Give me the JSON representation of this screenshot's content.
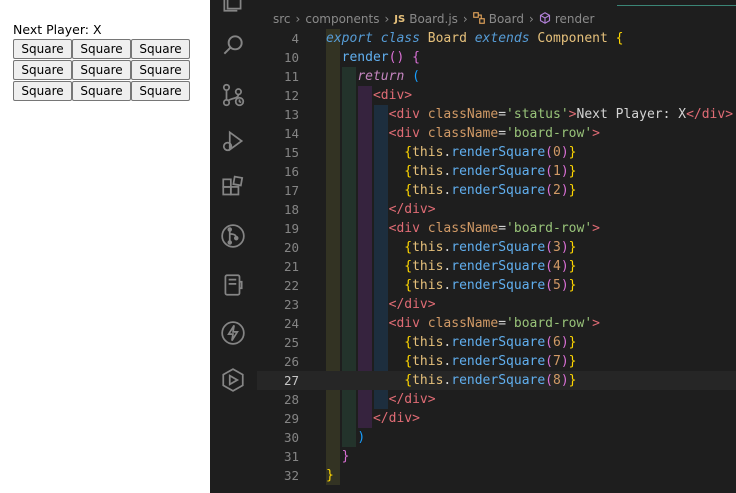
{
  "preview": {
    "status_text": "Next Player: X",
    "rows": [
      [
        "Square",
        "Square",
        "Square"
      ],
      [
        "Square",
        "Square",
        "Square"
      ],
      [
        "Square",
        "Square",
        "Square"
      ]
    ]
  },
  "activity_bar": {
    "icons": [
      "explorer-icon",
      "search-icon",
      "source-control-icon",
      "run-debug-icon",
      "extensions-icon",
      "git-graph-icon",
      "remote-icon",
      "thunder-client-icon",
      "live-share-icon"
    ]
  },
  "breadcrumb": {
    "items": [
      "src",
      "components",
      "Board.js",
      "Board",
      "render"
    ],
    "js_badge": "JS"
  },
  "code_lines": [
    {
      "n": "4",
      "parts": [
        [
          "kw",
          "export"
        ],
        [
          "plain",
          " "
        ],
        [
          "kw",
          "class"
        ],
        [
          "plain",
          " "
        ],
        [
          "cls",
          "Board"
        ],
        [
          "plain",
          " "
        ],
        [
          "kw",
          "extends"
        ],
        [
          "plain",
          " "
        ],
        [
          "cls",
          "Component"
        ],
        [
          "plain",
          " "
        ],
        [
          "br1",
          "{"
        ]
      ]
    },
    {
      "n": "10",
      "parts": [
        [
          "plain",
          "  "
        ],
        [
          "fn",
          "render"
        ],
        [
          "br2",
          "()"
        ],
        [
          "plain",
          " "
        ],
        [
          "br2",
          "{"
        ]
      ]
    },
    {
      "n": "11",
      "parts": [
        [
          "plain",
          "    "
        ],
        [
          "kw2",
          "return"
        ],
        [
          "plain",
          " "
        ],
        [
          "br3",
          "("
        ]
      ]
    },
    {
      "n": "12",
      "parts": [
        [
          "plain",
          "      "
        ],
        [
          "tag",
          "<div>"
        ]
      ]
    },
    {
      "n": "13",
      "parts": [
        [
          "plain",
          "        "
        ],
        [
          "tag",
          "<div"
        ],
        [
          "plain",
          " "
        ],
        [
          "attr",
          "className"
        ],
        [
          "plain",
          "="
        ],
        [
          "str",
          "'status'"
        ],
        [
          "tag",
          ">"
        ],
        [
          "plain",
          "Next Player: X"
        ],
        [
          "tag",
          "</div>"
        ]
      ]
    },
    {
      "n": "14",
      "parts": [
        [
          "plain",
          "        "
        ],
        [
          "tag",
          "<div"
        ],
        [
          "plain",
          " "
        ],
        [
          "attr",
          "className"
        ],
        [
          "plain",
          "="
        ],
        [
          "str",
          "'board-row'"
        ],
        [
          "tag",
          ">"
        ]
      ]
    },
    {
      "n": "15",
      "parts": [
        [
          "plain",
          "          "
        ],
        [
          "br1",
          "{"
        ],
        [
          "th",
          "this"
        ],
        [
          "plain",
          "."
        ],
        [
          "fn",
          "renderSquare"
        ],
        [
          "br2",
          "("
        ],
        [
          "num",
          "0"
        ],
        [
          "br2",
          ")"
        ],
        [
          "br1",
          "}"
        ]
      ]
    },
    {
      "n": "16",
      "parts": [
        [
          "plain",
          "          "
        ],
        [
          "br1",
          "{"
        ],
        [
          "th",
          "this"
        ],
        [
          "plain",
          "."
        ],
        [
          "fn",
          "renderSquare"
        ],
        [
          "br2",
          "("
        ],
        [
          "num",
          "1"
        ],
        [
          "br2",
          ")"
        ],
        [
          "br1",
          "}"
        ]
      ]
    },
    {
      "n": "17",
      "parts": [
        [
          "plain",
          "          "
        ],
        [
          "br1",
          "{"
        ],
        [
          "th",
          "this"
        ],
        [
          "plain",
          "."
        ],
        [
          "fn",
          "renderSquare"
        ],
        [
          "br2",
          "("
        ],
        [
          "num",
          "2"
        ],
        [
          "br2",
          ")"
        ],
        [
          "br1",
          "}"
        ]
      ]
    },
    {
      "n": "18",
      "parts": [
        [
          "plain",
          "        "
        ],
        [
          "tag",
          "</div>"
        ]
      ]
    },
    {
      "n": "19",
      "parts": [
        [
          "plain",
          "        "
        ],
        [
          "tag",
          "<div"
        ],
        [
          "plain",
          " "
        ],
        [
          "attr",
          "className"
        ],
        [
          "plain",
          "="
        ],
        [
          "str",
          "'board-row'"
        ],
        [
          "tag",
          ">"
        ]
      ]
    },
    {
      "n": "20",
      "parts": [
        [
          "plain",
          "          "
        ],
        [
          "br1",
          "{"
        ],
        [
          "th",
          "this"
        ],
        [
          "plain",
          "."
        ],
        [
          "fn",
          "renderSquare"
        ],
        [
          "br2",
          "("
        ],
        [
          "num",
          "3"
        ],
        [
          "br2",
          ")"
        ],
        [
          "br1",
          "}"
        ]
      ]
    },
    {
      "n": "21",
      "parts": [
        [
          "plain",
          "          "
        ],
        [
          "br1",
          "{"
        ],
        [
          "th",
          "this"
        ],
        [
          "plain",
          "."
        ],
        [
          "fn",
          "renderSquare"
        ],
        [
          "br2",
          "("
        ],
        [
          "num",
          "4"
        ],
        [
          "br2",
          ")"
        ],
        [
          "br1",
          "}"
        ]
      ]
    },
    {
      "n": "22",
      "parts": [
        [
          "plain",
          "          "
        ],
        [
          "br1",
          "{"
        ],
        [
          "th",
          "this"
        ],
        [
          "plain",
          "."
        ],
        [
          "fn",
          "renderSquare"
        ],
        [
          "br2",
          "("
        ],
        [
          "num",
          "5"
        ],
        [
          "br2",
          ")"
        ],
        [
          "br1",
          "}"
        ]
      ]
    },
    {
      "n": "23",
      "parts": [
        [
          "plain",
          "        "
        ],
        [
          "tag",
          "</div>"
        ]
      ]
    },
    {
      "n": "24",
      "parts": [
        [
          "plain",
          "        "
        ],
        [
          "tag",
          "<div"
        ],
        [
          "plain",
          " "
        ],
        [
          "attr",
          "className"
        ],
        [
          "plain",
          "="
        ],
        [
          "str",
          "'board-row'"
        ],
        [
          "tag",
          ">"
        ]
      ]
    },
    {
      "n": "25",
      "parts": [
        [
          "plain",
          "          "
        ],
        [
          "br1",
          "{"
        ],
        [
          "th",
          "this"
        ],
        [
          "plain",
          "."
        ],
        [
          "fn",
          "renderSquare"
        ],
        [
          "br2",
          "("
        ],
        [
          "num",
          "6"
        ],
        [
          "br2",
          ")"
        ],
        [
          "br1",
          "}"
        ]
      ]
    },
    {
      "n": "26",
      "parts": [
        [
          "plain",
          "          "
        ],
        [
          "br1",
          "{"
        ],
        [
          "th",
          "this"
        ],
        [
          "plain",
          "."
        ],
        [
          "fn",
          "renderSquare"
        ],
        [
          "br2",
          "("
        ],
        [
          "num",
          "7"
        ],
        [
          "br2",
          ")"
        ],
        [
          "br1",
          "}"
        ]
      ]
    },
    {
      "n": "27",
      "current": true,
      "parts": [
        [
          "plain",
          "          "
        ],
        [
          "br1",
          "{"
        ],
        [
          "th",
          "this"
        ],
        [
          "plain",
          "."
        ],
        [
          "fn",
          "renderSquare"
        ],
        [
          "br2",
          "("
        ],
        [
          "num",
          "8"
        ],
        [
          "br2",
          ")"
        ],
        [
          "br1",
          "}"
        ]
      ]
    },
    {
      "n": "28",
      "parts": [
        [
          "plain",
          "        "
        ],
        [
          "tag",
          "</div>"
        ]
      ]
    },
    {
      "n": "29",
      "parts": [
        [
          "plain",
          "      "
        ],
        [
          "tag",
          "</div>"
        ]
      ]
    },
    {
      "n": "30",
      "parts": [
        [
          "plain",
          "    "
        ],
        [
          "br3",
          ")"
        ]
      ]
    },
    {
      "n": "31",
      "parts": [
        [
          "plain",
          "  "
        ],
        [
          "br2",
          "}"
        ]
      ]
    },
    {
      "n": "32",
      "parts": [
        [
          "br1",
          "}"
        ]
      ]
    }
  ],
  "colors": {
    "editor_bg": "#1e1e1e",
    "keyword": "#569cd6",
    "tag": "#e06c75",
    "string": "#98c379",
    "function": "#61afef"
  }
}
